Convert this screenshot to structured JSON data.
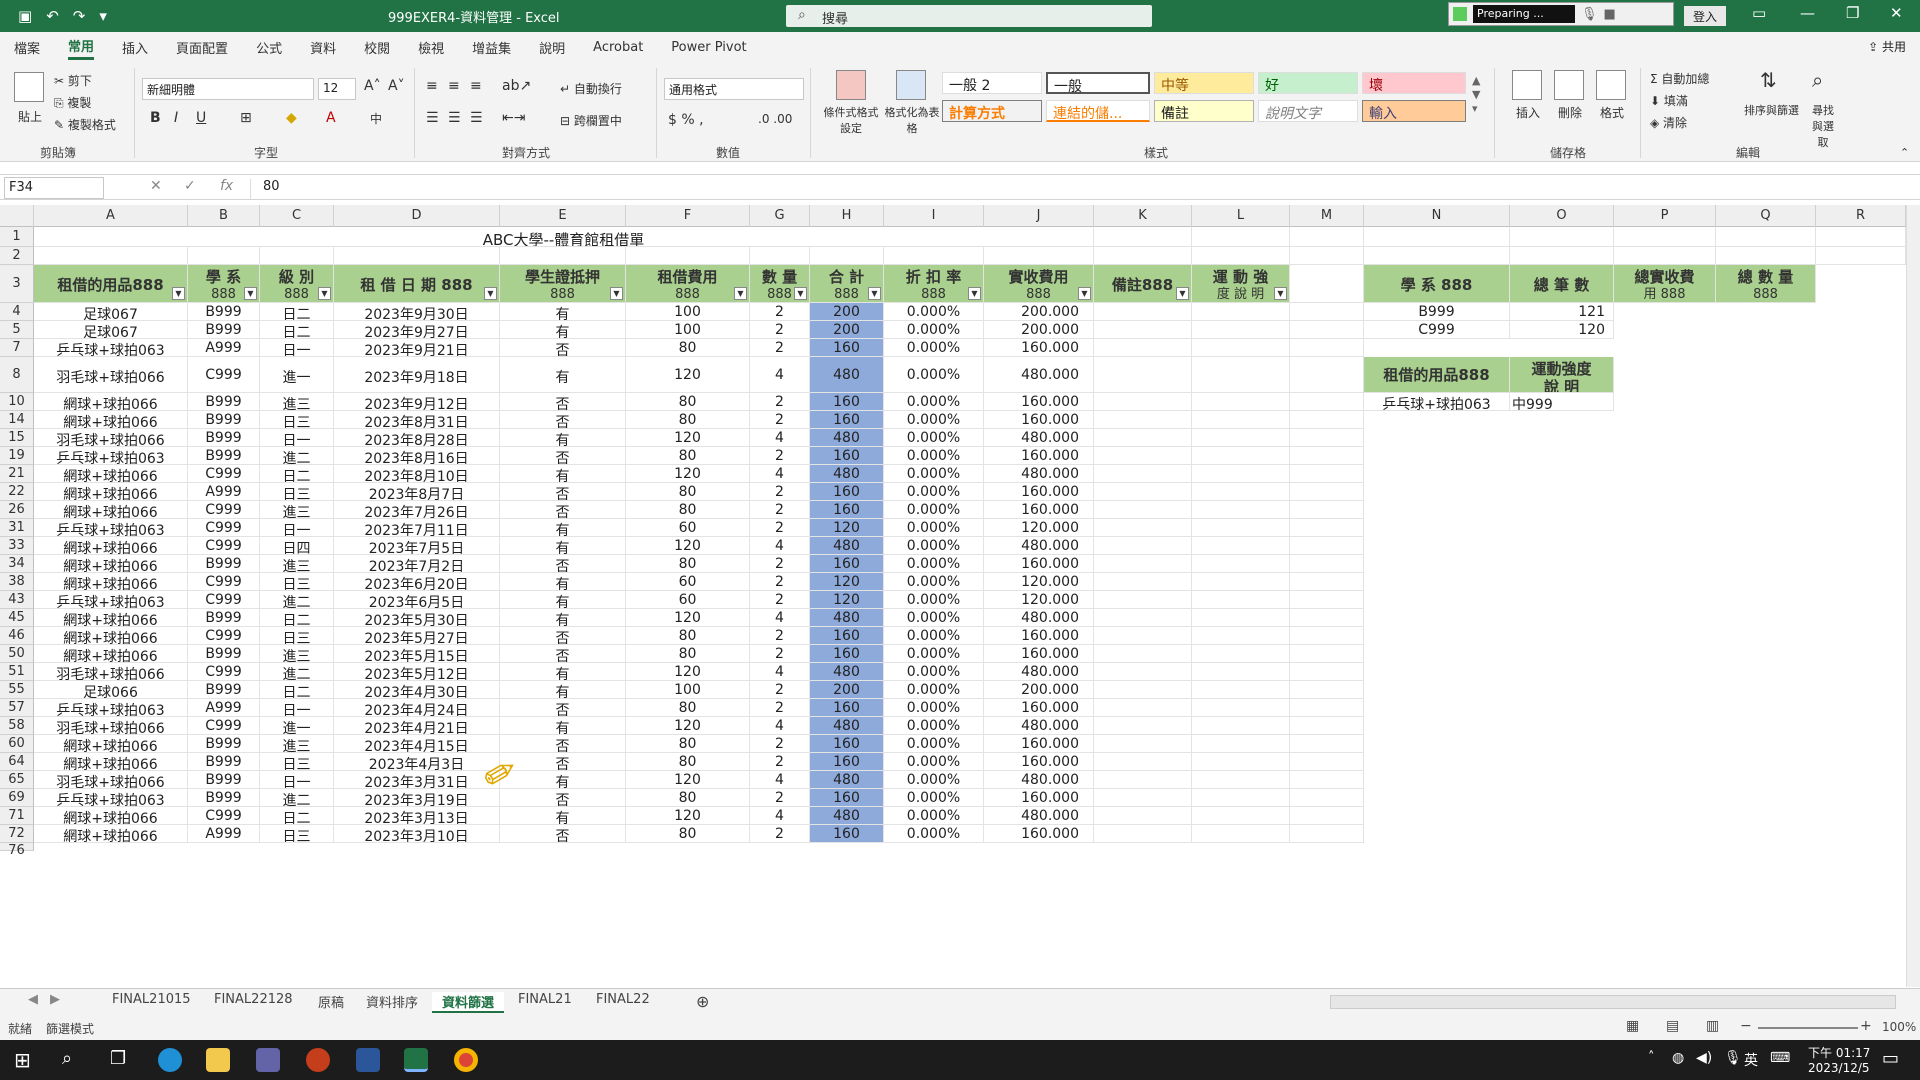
{
  "window": {
    "title": "999EXER4-資料管理 - Excel",
    "search": "搜尋",
    "recorder": "Preparing ...",
    "login": "登入"
  },
  "menu": [
    "檔案",
    "常用",
    "插入",
    "頁面配置",
    "公式",
    "資料",
    "校閱",
    "檢視",
    "增益集",
    "說明",
    "Acrobat",
    "Power Pivot"
  ],
  "share": "共用",
  "ribbon": {
    "clipboard": {
      "cut": "剪下",
      "copy": "複製",
      "painter": "複製格式",
      "paste": "貼上",
      "group": "剪貼簿"
    },
    "font": {
      "name": "新細明體",
      "size": "12",
      "group": "字型"
    },
    "align": {
      "wrap": "自動換行",
      "merge": "跨欄置中",
      "group": "對齊方式"
    },
    "number": {
      "format": "通用格式",
      "group": "數值"
    },
    "styles": {
      "cond": "條件式格式設定",
      "table": "格式化為表格",
      "s1": "一般 2",
      "s2": "一般",
      "s3": "中等",
      "s4": "好",
      "s5": "壞",
      "s6": "計算方式",
      "s7": "連結的儲...",
      "s8": "備註",
      "s9": "說明文字",
      "s10": "輸入",
      "group": "樣式"
    },
    "cells": {
      "insert": "插入",
      "delete": "刪除",
      "format": "格式",
      "group": "儲存格"
    },
    "edit": {
      "autosum": "自動加總",
      "fill": "填滿",
      "clear": "清除",
      "sort": "排序與篩選",
      "find": "尋找與選取",
      "group": "編輯"
    }
  },
  "formula": {
    "namebox": "F34",
    "value": "80"
  },
  "columns": [
    "A",
    "B",
    "C",
    "D",
    "E",
    "F",
    "G",
    "H",
    "I",
    "J",
    "K",
    "L",
    "M",
    "N",
    "O",
    "P",
    "Q",
    "R"
  ],
  "sheet": {
    "title": "ABC大學--體育館租借單",
    "headers": [
      {
        "l1": "租借的用品888",
        "l2": ""
      },
      {
        "l1": "學 系",
        "l2": "888"
      },
      {
        "l1": "級 別",
        "l2": "888"
      },
      {
        "l1": "租 借 日 期 888",
        "l2": ""
      },
      {
        "l1": "學生證抵押",
        "l2": "888"
      },
      {
        "l1": "租借費用",
        "l2": "888"
      },
      {
        "l1": "數 量",
        "l2": "888"
      },
      {
        "l1": "合 計",
        "l2": "888"
      },
      {
        "l1": "折 扣 率",
        "l2": "888"
      },
      {
        "l1": "實收費用",
        "l2": "888"
      },
      {
        "l1": "備註888",
        "l2": ""
      },
      {
        "l1": "運 動 強",
        "l2": "度 說 明"
      }
    ],
    "rows": [
      {
        "n": "4",
        "c": [
          "足球067",
          "B999",
          "日二",
          "2023年9月30日",
          "有",
          "100",
          "2",
          "200",
          "0.000%",
          "200.000"
        ]
      },
      {
        "n": "5",
        "c": [
          "足球067",
          "B999",
          "日二",
          "2023年9月27日",
          "有",
          "100",
          "2",
          "200",
          "0.000%",
          "200.000"
        ]
      },
      {
        "n": "7",
        "c": [
          "乒乓球+球拍063",
          "A999",
          "日一",
          "2023年9月21日",
          "否",
          "80",
          "2",
          "160",
          "0.000%",
          "160.000"
        ]
      },
      {
        "n": "8",
        "c": [
          "羽毛球+球拍066",
          "C999",
          "進一",
          "2023年9月18日",
          "有",
          "120",
          "4",
          "480",
          "0.000%",
          "480.000"
        ]
      },
      {
        "n": "10",
        "c": [
          "網球+球拍066",
          "B999",
          "進三",
          "2023年9月12日",
          "否",
          "80",
          "2",
          "160",
          "0.000%",
          "160.000"
        ]
      },
      {
        "n": "14",
        "c": [
          "網球+球拍066",
          "B999",
          "日三",
          "2023年8月31日",
          "否",
          "80",
          "2",
          "160",
          "0.000%",
          "160.000"
        ]
      },
      {
        "n": "15",
        "c": [
          "羽毛球+球拍066",
          "B999",
          "日一",
          "2023年8月28日",
          "有",
          "120",
          "4",
          "480",
          "0.000%",
          "480.000"
        ]
      },
      {
        "n": "19",
        "c": [
          "乒乓球+球拍063",
          "B999",
          "進二",
          "2023年8月16日",
          "否",
          "80",
          "2",
          "160",
          "0.000%",
          "160.000"
        ]
      },
      {
        "n": "21",
        "c": [
          "網球+球拍066",
          "C999",
          "日二",
          "2023年8月10日",
          "有",
          "120",
          "4",
          "480",
          "0.000%",
          "480.000"
        ]
      },
      {
        "n": "22",
        "c": [
          "網球+球拍066",
          "A999",
          "日三",
          "2023年8月7日",
          "否",
          "80",
          "2",
          "160",
          "0.000%",
          "160.000"
        ]
      },
      {
        "n": "26",
        "c": [
          "網球+球拍066",
          "C999",
          "進三",
          "2023年7月26日",
          "否",
          "80",
          "2",
          "160",
          "0.000%",
          "160.000"
        ]
      },
      {
        "n": "31",
        "c": [
          "乒乓球+球拍063",
          "C999",
          "日一",
          "2023年7月11日",
          "有",
          "60",
          "2",
          "120",
          "0.000%",
          "120.000"
        ]
      },
      {
        "n": "33",
        "c": [
          "網球+球拍066",
          "C999",
          "日四",
          "2023年7月5日",
          "有",
          "120",
          "4",
          "480",
          "0.000%",
          "480.000"
        ]
      },
      {
        "n": "34",
        "c": [
          "網球+球拍066",
          "B999",
          "進三",
          "2023年7月2日",
          "否",
          "80",
          "2",
          "160",
          "0.000%",
          "160.000"
        ]
      },
      {
        "n": "38",
        "c": [
          "網球+球拍066",
          "C999",
          "日三",
          "2023年6月20日",
          "有",
          "60",
          "2",
          "120",
          "0.000%",
          "120.000"
        ]
      },
      {
        "n": "43",
        "c": [
          "乒乓球+球拍063",
          "C999",
          "進二",
          "2023年6月5日",
          "有",
          "60",
          "2",
          "120",
          "0.000%",
          "120.000"
        ]
      },
      {
        "n": "45",
        "c": [
          "網球+球拍066",
          "B999",
          "日二",
          "2023年5月30日",
          "有",
          "120",
          "4",
          "480",
          "0.000%",
          "480.000"
        ]
      },
      {
        "n": "46",
        "c": [
          "網球+球拍066",
          "C999",
          "日三",
          "2023年5月27日",
          "否",
          "80",
          "2",
          "160",
          "0.000%",
          "160.000"
        ]
      },
      {
        "n": "50",
        "c": [
          "網球+球拍066",
          "B999",
          "進三",
          "2023年5月15日",
          "否",
          "80",
          "2",
          "160",
          "0.000%",
          "160.000"
        ]
      },
      {
        "n": "51",
        "c": [
          "羽毛球+球拍066",
          "C999",
          "進二",
          "2023年5月12日",
          "有",
          "120",
          "4",
          "480",
          "0.000%",
          "480.000"
        ]
      },
      {
        "n": "55",
        "c": [
          "足球066",
          "B999",
          "日二",
          "2023年4月30日",
          "有",
          "100",
          "2",
          "200",
          "0.000%",
          "200.000"
        ]
      },
      {
        "n": "57",
        "c": [
          "乒乓球+球拍063",
          "A999",
          "日一",
          "2023年4月24日",
          "否",
          "80",
          "2",
          "160",
          "0.000%",
          "160.000"
        ]
      },
      {
        "n": "58",
        "c": [
          "羽毛球+球拍066",
          "C999",
          "進一",
          "2023年4月21日",
          "有",
          "120",
          "4",
          "480",
          "0.000%",
          "480.000"
        ]
      },
      {
        "n": "60",
        "c": [
          "網球+球拍066",
          "B999",
          "進三",
          "2023年4月15日",
          "否",
          "80",
          "2",
          "160",
          "0.000%",
          "160.000"
        ]
      },
      {
        "n": "64",
        "c": [
          "網球+球拍066",
          "B999",
          "日三",
          "2023年4月3日",
          "否",
          "80",
          "2",
          "160",
          "0.000%",
          "160.000"
        ]
      },
      {
        "n": "65",
        "c": [
          "羽毛球+球拍066",
          "B999",
          "日一",
          "2023年3月31日",
          "有",
          "120",
          "4",
          "480",
          "0.000%",
          "480.000"
        ]
      },
      {
        "n": "69",
        "c": [
          "乒乓球+球拍063",
          "B999",
          "進二",
          "2023年3月19日",
          "否",
          "80",
          "2",
          "160",
          "0.000%",
          "160.000"
        ]
      },
      {
        "n": "71",
        "c": [
          "網球+球拍066",
          "C999",
          "日二",
          "2023年3月13日",
          "有",
          "120",
          "4",
          "480",
          "0.000%",
          "480.000"
        ]
      },
      {
        "n": "72",
        "c": [
          "網球+球拍066",
          "A999",
          "日三",
          "2023年3月10日",
          "否",
          "80",
          "2",
          "160",
          "0.000%",
          "160.000"
        ]
      }
    ],
    "side": {
      "h": [
        "學 系 888",
        "總 筆 數",
        "總實收費",
        "總 數 量"
      ],
      "h2": [
        "",
        "",
        "用 888",
        "888"
      ],
      "r1": [
        "B999",
        "121"
      ],
      "r2": [
        "C999",
        "120"
      ],
      "h3": [
        "租借的用品888",
        "運動強度"
      ],
      "h3b": "說 明",
      "r3": [
        "乒乓球+球拍063",
        "中999"
      ]
    }
  },
  "sheets": [
    "FINAL21015",
    "FINAL22128",
    "原稿",
    "資料排序",
    "資料篩選",
    "FINAL21",
    "FINAL22"
  ],
  "status": {
    "ready": "就緒",
    "mode": "篩選模式",
    "zoom": "100%"
  },
  "taskbar": {
    "ime": "英",
    "time": "下午 01:17",
    "date": "2023/12/5"
  }
}
